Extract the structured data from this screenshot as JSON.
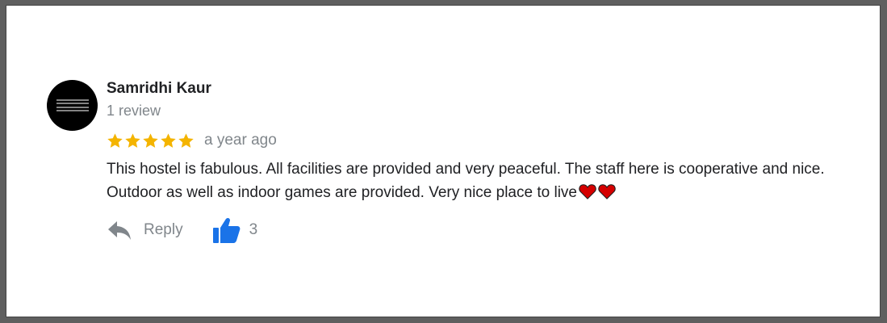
{
  "review": {
    "author": "Samridhi Kaur",
    "review_count": "1 review",
    "rating": 5,
    "rating_max": 5,
    "date": "a year ago",
    "text": "This hostel is fabulous. All facilities are provided and very peaceful. The staff here is cooperative and nice. Outdoor as well as indoor games are provided. Very nice place to live",
    "emoji": [
      "red-heart-icon",
      "red-heart-icon"
    ]
  },
  "actions": {
    "reply_label": "Reply",
    "like_count": "3"
  },
  "colors": {
    "star": "#f4b400",
    "like": "#1a73e8",
    "heart": "#d50000",
    "muted_text": "#80868b"
  }
}
